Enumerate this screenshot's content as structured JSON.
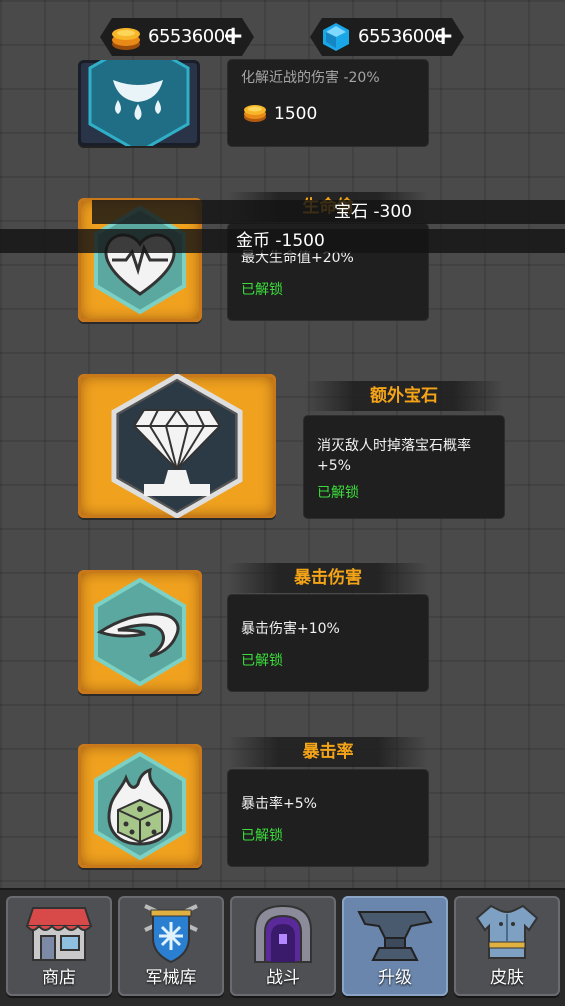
{
  "currency": {
    "coins": "65536000",
    "gems": "65536000",
    "plus": "+"
  },
  "skills": [
    {
      "id": "partial-top",
      "title": "",
      "desc": "化解近战的伤害 -20%",
      "price": "1500",
      "unlocked": ""
    },
    {
      "id": "life-drain",
      "title": "生命偷",
      "desc": "最大生命值+20%",
      "unlocked": "已解锁"
    },
    {
      "id": "extra-gem",
      "title": "额外宝石",
      "desc": "消灭敌人时掉落宝石概率+5%",
      "unlocked": "已解锁"
    },
    {
      "id": "crit-damage",
      "title": "暴击伤害",
      "desc": "暴击伤害+10%",
      "unlocked": "已解锁"
    },
    {
      "id": "crit-rate",
      "title": "暴击率",
      "desc": "暴击率+5%",
      "unlocked": "已解锁"
    }
  ],
  "toasts": {
    "gem_cost": "宝石 -300",
    "coin_cost": "金币 -1500"
  },
  "nav": [
    {
      "label": "商店",
      "icon": "shop-icon"
    },
    {
      "label": "军械库",
      "icon": "armory-icon"
    },
    {
      "label": "战斗",
      "icon": "battle-icon"
    },
    {
      "label": "升级",
      "icon": "anvil-icon",
      "active": true
    },
    {
      "label": "皮肤",
      "icon": "armor-icon"
    }
  ],
  "colors": {
    "title_orange": "#f5a418",
    "unlocked_green": "#3bdc3b",
    "frame_gold": "#f0a21f",
    "active_nav": "#6a86ac"
  }
}
